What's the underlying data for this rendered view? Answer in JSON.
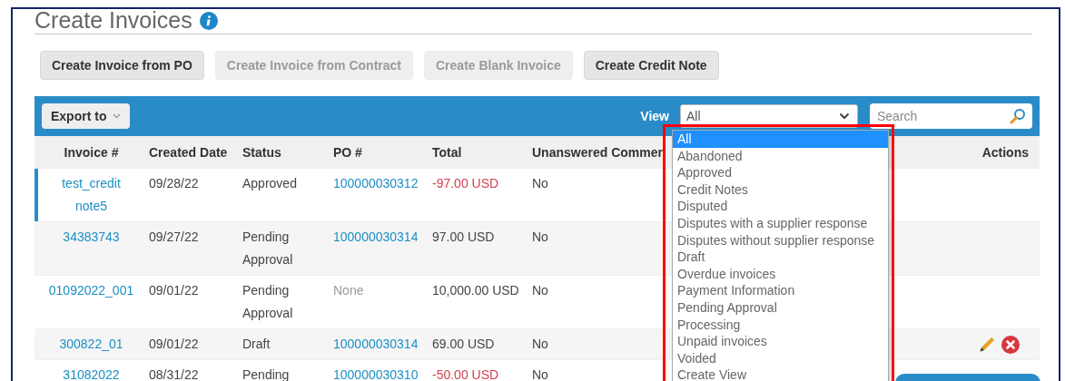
{
  "page": {
    "title": "Create Invoices"
  },
  "buttons": [
    {
      "label": "Create Invoice from PO",
      "disabled": false
    },
    {
      "label": "Create Invoice from Contract",
      "disabled": true
    },
    {
      "label": "Create Blank Invoice",
      "disabled": true
    },
    {
      "label": "Create Credit Note",
      "disabled": false
    }
  ],
  "toolbar": {
    "export_label": "Export to",
    "view_label": "View",
    "view_value": "All",
    "search": {
      "placeholder": "Search"
    }
  },
  "table": {
    "columns": [
      "Invoice #",
      "Created Date",
      "Status",
      "PO #",
      "Total",
      "Unanswered Commer",
      "Actions"
    ],
    "rows": [
      {
        "selected": true,
        "invoice": "test_credit note5",
        "created": "09/28/22",
        "status": "Approved",
        "po": {
          "text": "100000030312",
          "link": true
        },
        "total": {
          "text": "-97.00 USD",
          "negative": true
        },
        "unanswered": "No"
      },
      {
        "selected": false,
        "invoice": "34383743",
        "created": "09/27/22",
        "status": "Pending Approval",
        "po": {
          "text": "100000030314",
          "link": true
        },
        "total": {
          "text": "97.00 USD",
          "negative": false
        },
        "unanswered": "No"
      },
      {
        "selected": false,
        "invoice": "01092022_001",
        "created": "09/01/22",
        "status": "Pending Approval",
        "po": {
          "text": "None",
          "link": false
        },
        "total": {
          "text": "10,000.00 USD",
          "negative": false
        },
        "unanswered": "No"
      },
      {
        "selected": false,
        "invoice": "300822_01",
        "created": "09/01/22",
        "status": "Draft",
        "po": {
          "text": "100000030314",
          "link": true
        },
        "total": {
          "text": "69.00 USD",
          "negative": false
        },
        "unanswered": "No",
        "actions": [
          {
            "kind": "edit"
          },
          {
            "kind": "delete"
          }
        ]
      },
      {
        "selected": false,
        "invoice": "31082022",
        "created": "08/31/22",
        "status": "Pending",
        "po": {
          "text": "100000030310",
          "link": true
        },
        "total": {
          "text": "-50.00 USD",
          "negative": true
        },
        "unanswered": "No"
      }
    ]
  },
  "view_dropdown": {
    "options": [
      {
        "label": "All",
        "selected": true
      },
      {
        "label": "Abandoned",
        "selected": false
      },
      {
        "label": "Approved",
        "selected": false
      },
      {
        "label": "Credit Notes",
        "selected": false
      },
      {
        "label": "Disputed",
        "selected": false
      },
      {
        "label": "Disputes with a supplier response",
        "selected": false
      },
      {
        "label": "Disputes without supplier response",
        "selected": false
      },
      {
        "label": "Draft",
        "selected": false
      },
      {
        "label": "Overdue invoices",
        "selected": false
      },
      {
        "label": "Payment Information",
        "selected": false
      },
      {
        "label": "Pending Approval",
        "selected": false
      },
      {
        "label": "Processing",
        "selected": false
      },
      {
        "label": "Unpaid invoices",
        "selected": false
      },
      {
        "label": "Voided",
        "selected": false
      },
      {
        "label": "Create View",
        "selected": false
      }
    ]
  }
}
